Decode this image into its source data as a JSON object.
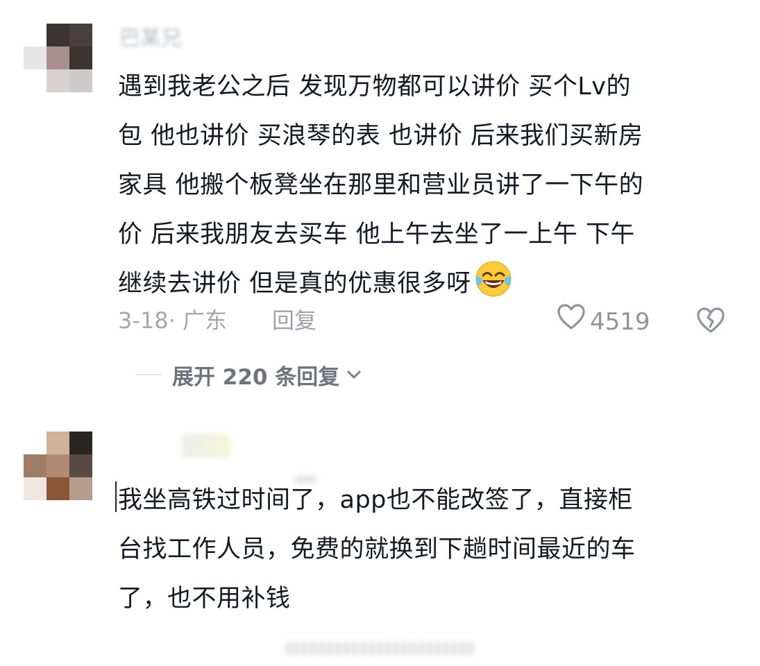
{
  "comments": [
    {
      "username": "巴某兄",
      "text_lines": [
        "遇到我老公之后 发现万物都可以讲价 买个Lv的",
        "包 他也讲价 买浪琴的表 也讲价 后来我们买新房",
        "家具 他搬个板凳坐在那里和营业员讲了一下午的",
        "价 后来我朋友去买车 他上午去坐了一上午 下午",
        "继续去讲价  但是真的优惠很多呀"
      ],
      "emoji": "laughing-tears-emoji",
      "time_location": "3-18· 广东",
      "reply_label": "回复",
      "like_count": "4519",
      "expand_label": "展开 220 条回复"
    },
    {
      "text_lines": [
        "我坐高铁过时间了，app也不能改签了，直接柜",
        "台找工作人员，免费的就换到下趟时间最近的车",
        "了，也不用补钱"
      ]
    }
  ],
  "icons": {
    "like": "heart-outline-icon",
    "dislike": "broken-heart-icon",
    "expand": "chevron-down-icon"
  },
  "colors": {
    "text": "#161823",
    "meta": "#a3a7af",
    "expand": "#6f737c"
  }
}
